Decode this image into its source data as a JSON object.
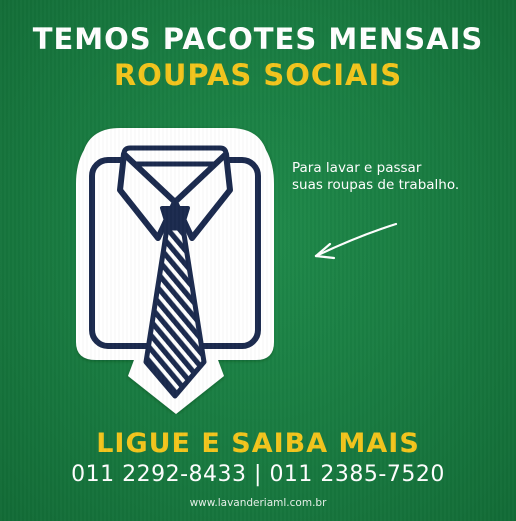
{
  "headline": {
    "line1": "TEMOS PACOTES MENSAIS",
    "line2": "ROUPAS SOCIAIS"
  },
  "illustration": {
    "icon": "shirt-and-tie-icon"
  },
  "caption": {
    "line1": "Para lavar e passar",
    "line2": "suas roupas de trabalho."
  },
  "arrow": {
    "icon": "arrow-left-icon"
  },
  "call_to_action": "LIGUE E SAIBA MAIS",
  "phones": "011 2292-8433 | 011 2385-7520",
  "website": "www.lavanderiaml.com.br",
  "colors": {
    "background": "#187a40",
    "accent_yellow": "#f3c51d",
    "navy": "#1b2a4e",
    "white": "#ffffff"
  }
}
